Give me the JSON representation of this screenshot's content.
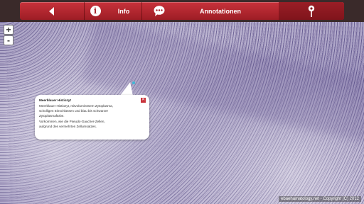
{
  "toolbar": {
    "back_icon": "chevron-left-icon",
    "info_icon_glyph": "i",
    "info_label": "Info",
    "annotations_icon": "speech-bubble-icon",
    "annotations_label": "Annotationen",
    "pin_icon": "map-pin-icon",
    "accent_color": "#b7272f"
  },
  "zoom": {
    "in_label": "+",
    "out_label": "-"
  },
  "popup": {
    "title": "Meerblauer Histiozyt",
    "lines": [
      "Meerblauer Histiozyt, mitvoluminösem Zytoplasma,",
      "scholligen Einschlüssen und blau bis schwarzer",
      "Zytoplasmafärbe.",
      "Vorkommen, wie die Pseudo-Gaucher-Zellen,",
      "aufgrund des vermehrten Zellumsatzes."
    ],
    "close_icon": "close-icon"
  },
  "copyright": "ebaehamatology.net - Copyright (C) 2012"
}
